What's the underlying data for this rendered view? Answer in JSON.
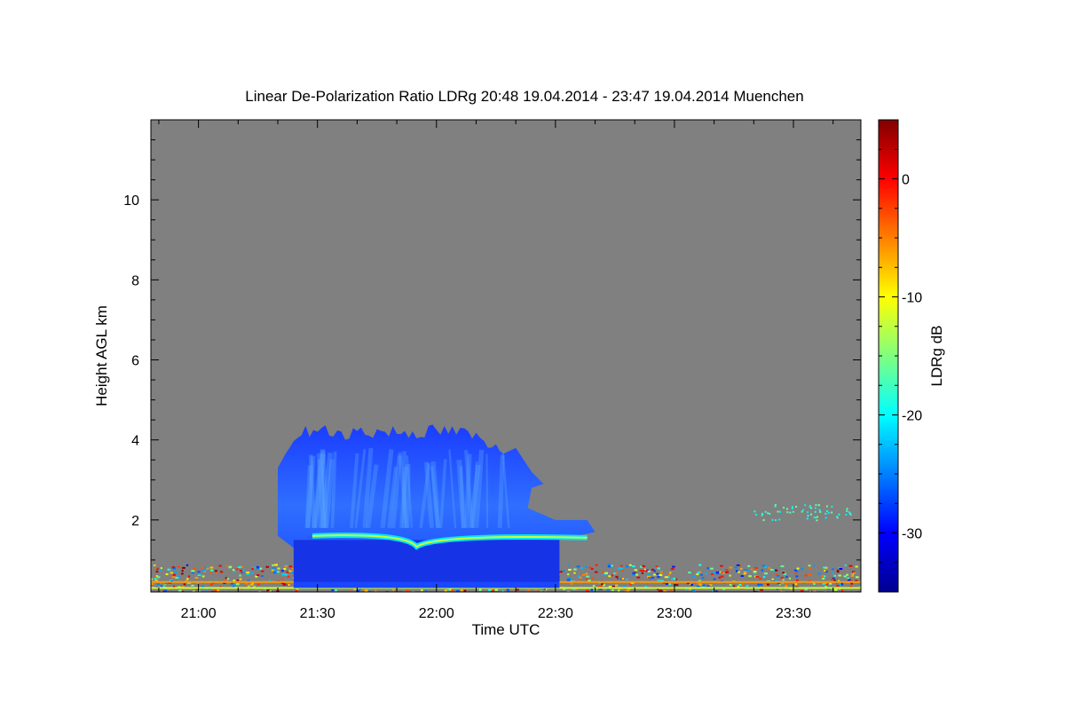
{
  "chart_data": {
    "type": "heatmap",
    "title": "Linear De-Polarization Ratio LDRg   20:48 19.04.2014 - 23:47 19.04.2014 Muenchen",
    "xlabel": "Time UTC",
    "ylabel": "Height AGL km",
    "colorbar_label": "LDRg dB",
    "x_ticks": [
      "21:00",
      "21:30",
      "22:00",
      "22:30",
      "23:00",
      "23:30"
    ],
    "y_ticks": [
      "2",
      "4",
      "6",
      "8",
      "10"
    ],
    "colorbar_ticks": [
      "0",
      "-10",
      "-20",
      "-30"
    ],
    "xlim": [
      "20:48",
      "23:47"
    ],
    "ylim": [
      0.2,
      12
    ],
    "clim": [
      -35,
      5
    ],
    "background_color": "#808080",
    "colormap": "jet",
    "features": [
      {
        "name": "cloud",
        "x": [
          "21:20",
          "22:40"
        ],
        "top_km": 4.4,
        "base_km": 0.3,
        "ldr_db": -30
      },
      {
        "name": "melting-layer",
        "x": [
          "21:22",
          "22:38"
        ],
        "height_km": 1.6,
        "ldr_db": -21
      },
      {
        "name": "boundary-layer-clutter",
        "x": [
          "20:48",
          "23:47"
        ],
        "height_km": [
          0.2,
          0.9
        ],
        "ldr_db": -12
      },
      {
        "name": "sparse-echoes",
        "x": [
          "23:20",
          "23:47"
        ],
        "height_km": [
          2.0,
          2.4
        ],
        "ldr_db": -18
      }
    ]
  }
}
